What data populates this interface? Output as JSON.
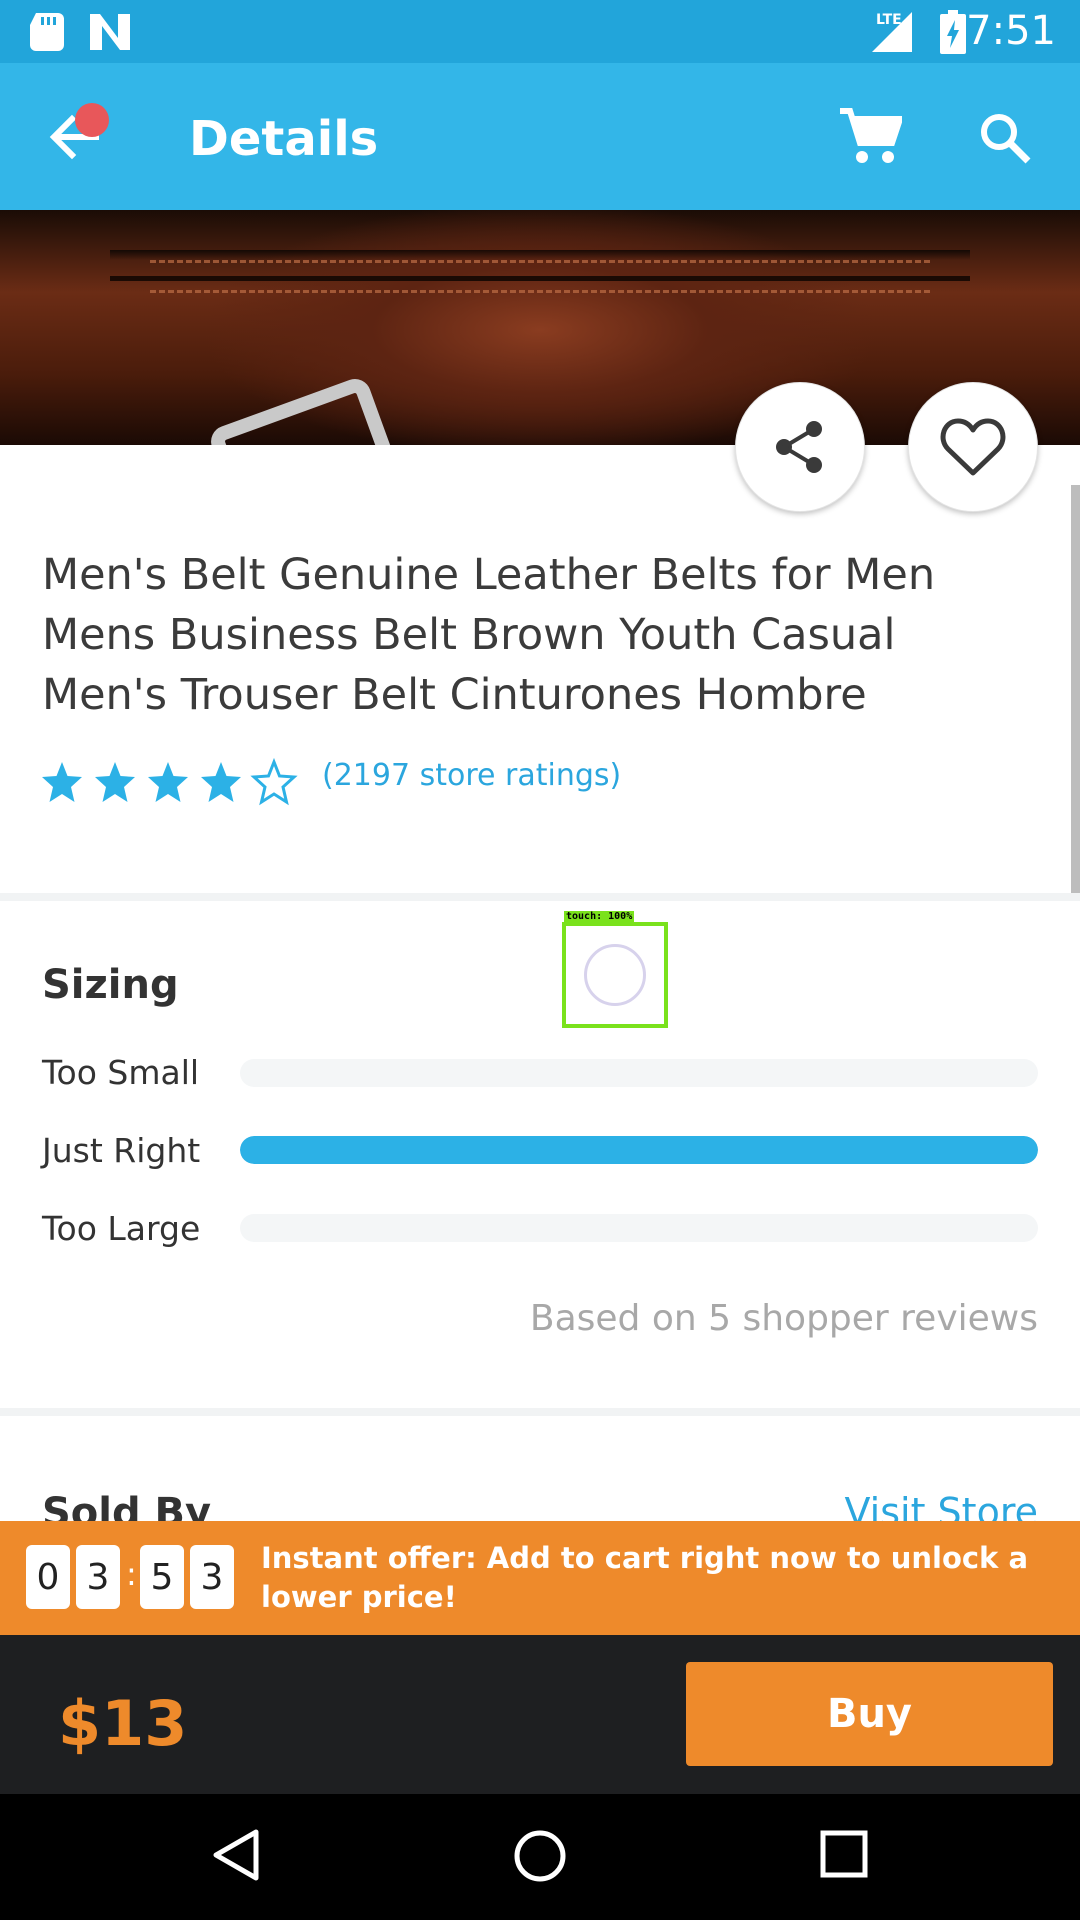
{
  "status_bar": {
    "time": "7:51",
    "network": "LTE",
    "icons": [
      "sd-card-icon",
      "n-notification-icon",
      "signal-icon",
      "battery-charging-icon"
    ]
  },
  "app_bar": {
    "title": "Details",
    "back_icon": "back-arrow-icon",
    "cart_icon": "cart-icon",
    "search_icon": "search-icon",
    "notification_dot_color": "#e8575a"
  },
  "product": {
    "title": "Men's Belt Genuine Leather Belts for Men Mens Business Belt Brown Youth Casual Men's Trouser Belt Cinturones Hombre",
    "rating_stars": 4.5,
    "ratings_text": "(2197 store ratings)",
    "share_icon": "share-icon",
    "wishlist_icon": "heart-icon"
  },
  "sizing": {
    "heading": "Sizing",
    "rows": [
      {
        "label": "Too Small",
        "fraction": 0.0
      },
      {
        "label": "Just Right",
        "fraction": 1.0
      },
      {
        "label": "Too Large",
        "fraction": 0.0
      }
    ],
    "note": "Based on 5 shopper reviews"
  },
  "sold_by": {
    "heading": "Sold By",
    "link": "Visit Store"
  },
  "offer": {
    "timer_digits": [
      "0",
      "3",
      "5",
      "3"
    ],
    "timer_separator": ":",
    "text": "Instant offer: Add to cart right now to unlock a lower price!"
  },
  "purchase": {
    "price": "$13",
    "buy_label": "Buy"
  },
  "touch_overlay": {
    "label": "touch: 100%"
  },
  "colors": {
    "accent": "#33b6e8",
    "status_bar": "#22a5da",
    "offer": "#ee8a2b",
    "bottom_bar": "#1e1f21"
  }
}
